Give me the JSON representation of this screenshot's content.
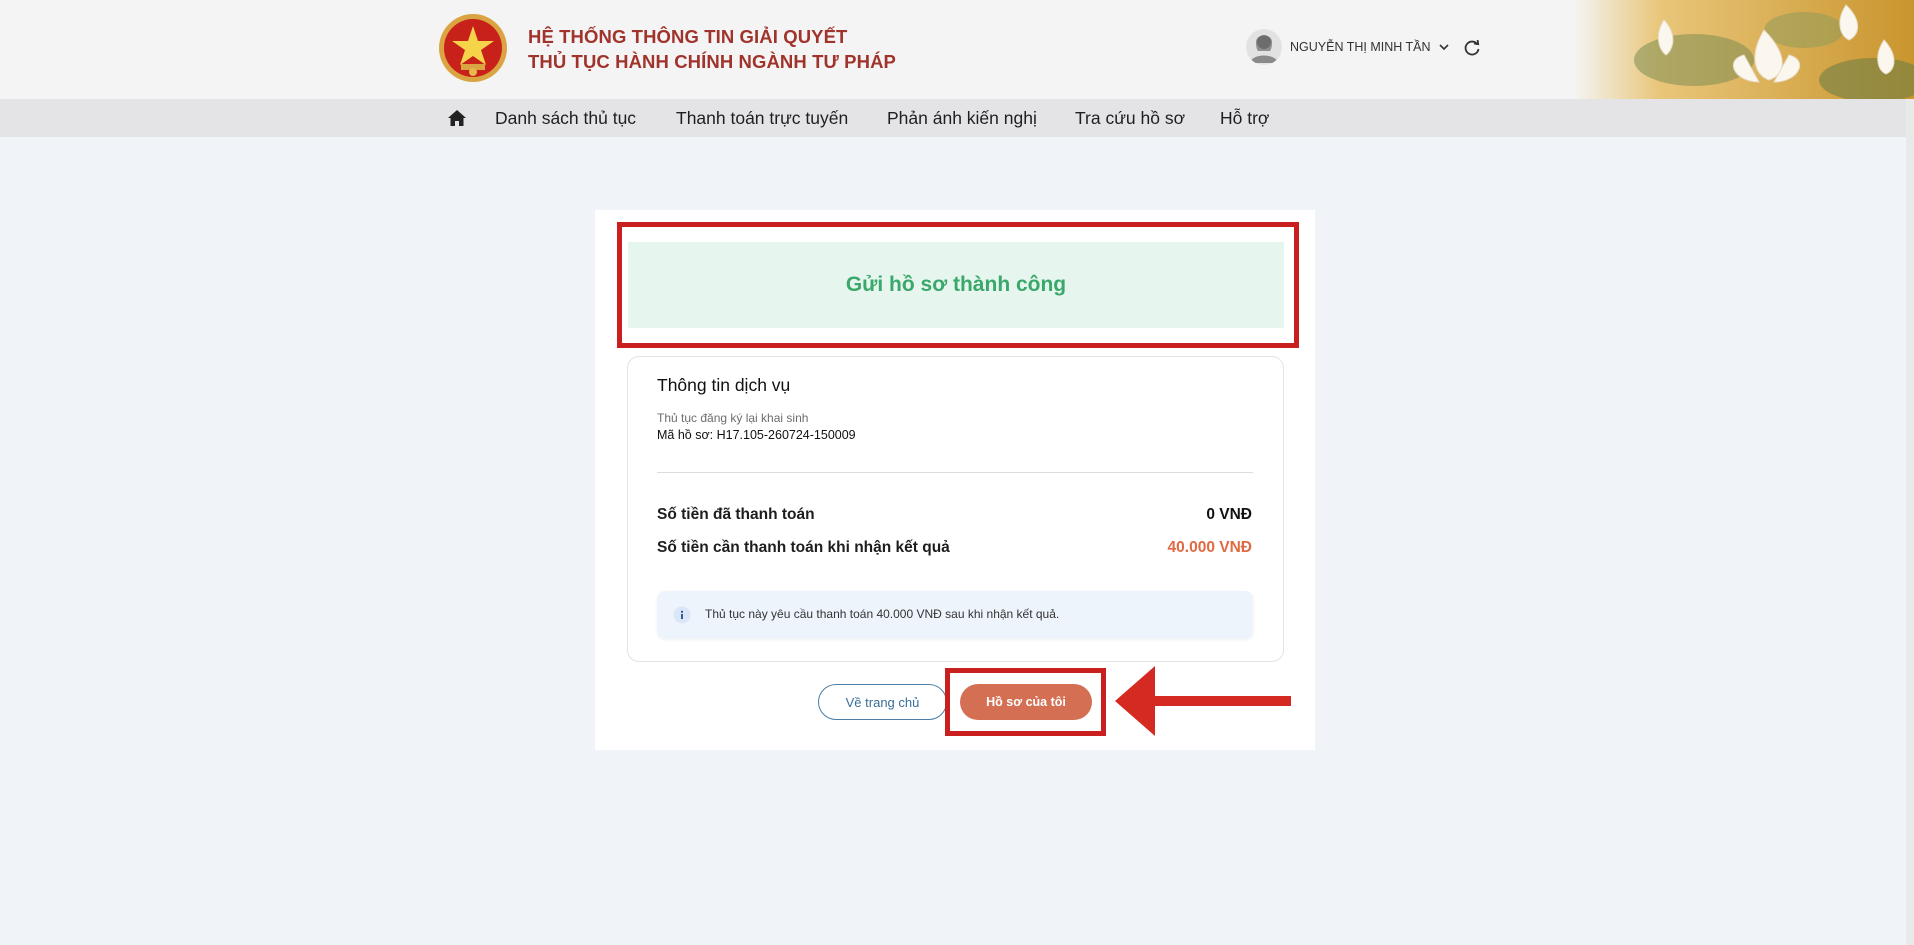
{
  "header": {
    "title_line1": "HỆ THỐNG THÔNG TIN GIẢI QUYẾT",
    "title_line2": "THỦ TỤC HÀNH CHÍNH NGÀNH TƯ PHÁP",
    "user_name": "NGUYỄN THỊ MINH TẦN",
    "brand_color": "#a0332c"
  },
  "nav": {
    "items": [
      "Danh sách thủ tục",
      "Thanh toán trực tuyến",
      "Phản ánh kiến nghị",
      "Tra cứu hồ sơ",
      "Hỗ trợ"
    ]
  },
  "result": {
    "success_message": "Gửi hồ sơ thành công",
    "service_title": "Thông tin dịch vụ",
    "procedure_name": "Thủ tục đăng ký lại khai sinh",
    "code_label": "Mã hồ sơ:",
    "code_value": "H17.105-260724-150009",
    "paid_label": "Số tiền đã thanh toán",
    "paid_value": "0 VNĐ",
    "due_label": "Số tiền cần thanh toán khi nhận kết quả",
    "due_value": "40.000 VNĐ",
    "notice_text": "Thủ tục này yêu cầu thanh toán 40.000 VNĐ sau khi nhận kết quả.",
    "success_color": "#3aa86a",
    "due_color": "#e06a43"
  },
  "actions": {
    "home_label": "Về trang chủ",
    "my_records_label": "Hồ sơ của tôi",
    "accent_color": "#d56f53"
  },
  "annotation": {
    "highlight_color": "#c9201f"
  }
}
